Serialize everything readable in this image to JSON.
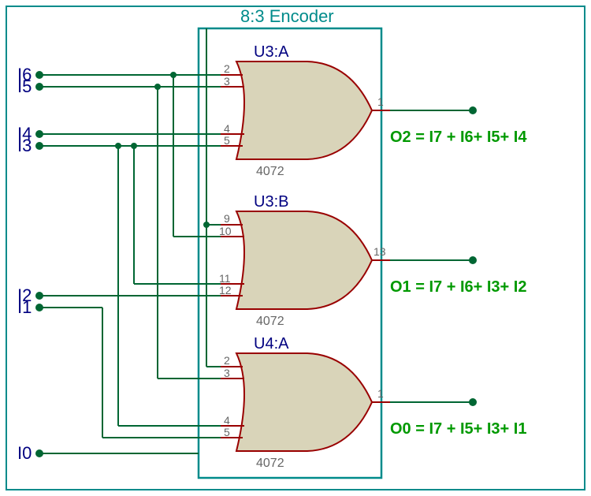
{
  "title": "8:3 Encoder",
  "inputs": {
    "i6": "I6",
    "i5": "I5",
    "i4": "I4",
    "i3": "I3",
    "i2": "I2",
    "i1": "I1",
    "i0": "I0"
  },
  "gates": {
    "u3a": {
      "label": "U3:A",
      "part": "4072",
      "pins": {
        "p1": "2",
        "p2": "3",
        "p3": "4",
        "p4": "5",
        "out": "1"
      }
    },
    "u3b": {
      "label": "U3:B",
      "part": "4072",
      "pins": {
        "p1": "9",
        "p2": "10",
        "p3": "11",
        "p4": "12",
        "out": "13"
      }
    },
    "u4a": {
      "label": "U4:A",
      "part": "4072",
      "pins": {
        "p1": "2",
        "p2": "3",
        "p3": "4",
        "p4": "5",
        "out": "1"
      }
    }
  },
  "outputs": {
    "o2": "O2 = I7 + I6+ I5+ I4",
    "o1": "O1 = I7 + I6+ I3+ I2",
    "o0": "O0 = I7 + I5+ I3+ I1"
  }
}
